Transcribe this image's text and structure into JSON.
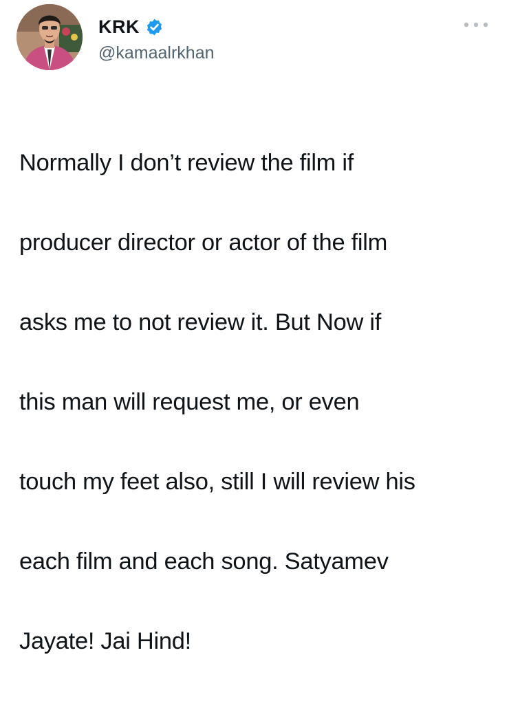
{
  "tweet": {
    "author": {
      "display_name": "KRK",
      "handle": "@kamaalrkhan",
      "verified": true
    },
    "text_lines": [
      "Normally I don’t review the film if",
      "producer director or actor of the film",
      "asks me to not review it. But Now if",
      "this man will request me, or even",
      "touch my feet also, still I will review his",
      "each film and each song. Satyamev",
      "Jayate! Jai Hind!"
    ]
  },
  "icons": {
    "verified": "verified-badge-icon",
    "more": "more-options-icon"
  },
  "colors": {
    "verified_blue": "#1d9bf0",
    "handle_gray": "#536471",
    "text": "#0f1419",
    "more_gray": "#b9bec3"
  }
}
